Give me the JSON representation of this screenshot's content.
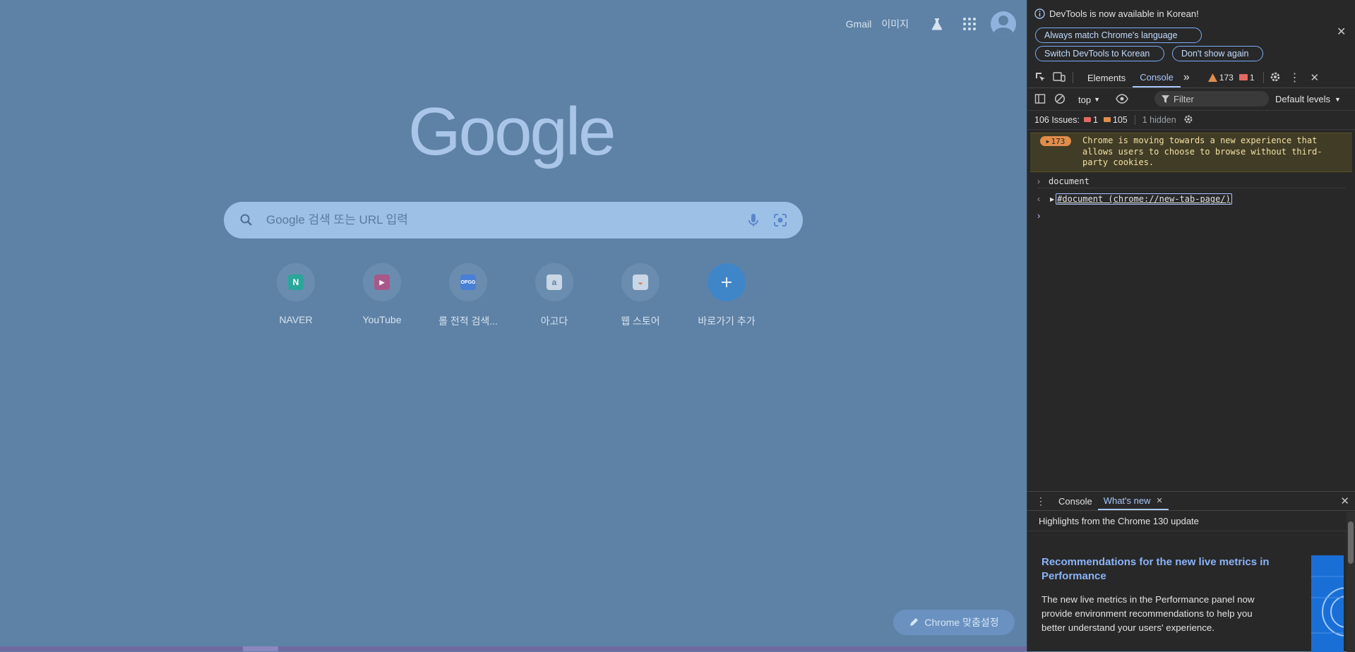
{
  "ntp": {
    "top_links": {
      "gmail": "Gmail",
      "images": "이미지"
    },
    "logo_text": "Google",
    "search": {
      "placeholder": "Google 검색 또는 URL 입력"
    },
    "shortcuts": [
      {
        "label": "NAVER",
        "icon": "naver-icon",
        "color": "#2bb34a"
      },
      {
        "label": "YouTube",
        "icon": "youtube-icon",
        "color": "#b23a6e"
      },
      {
        "label": "롤 전적 검색...",
        "icon": "opgg-icon",
        "color": "#4a7fd6"
      },
      {
        "label": "아고다",
        "icon": "agoda-icon",
        "color": "#e8eef6"
      },
      {
        "label": "웹 스토어",
        "icon": "webstore-icon",
        "color": "#e8eef6"
      },
      {
        "label": "바로가기 추가",
        "icon": "plus-icon",
        "color": "#3f86c8"
      }
    ],
    "customize_label": "Chrome 맞춤설정"
  },
  "devtools": {
    "banner": {
      "message": "DevTools is now available in Korean!",
      "btn_match": "Always match Chrome's language",
      "btn_switch": "Switch DevTools to Korean",
      "btn_dont_show": "Don't show again"
    },
    "tabs": {
      "elements": "Elements",
      "console": "Console"
    },
    "counts": {
      "warnings": "173",
      "errors": "1"
    },
    "toolbar": {
      "context": "top",
      "filter_placeholder": "Filter",
      "levels": "Default levels"
    },
    "issues": {
      "label": "106 Issues:",
      "errors": "1",
      "warnings": "105",
      "hidden": "1 hidden"
    },
    "console": {
      "warning_count": "173",
      "warning_text": "Chrome is moving towards a new experience that allows users to choose to browse without third-party cookies.",
      "input_line": "document",
      "result_line": "#document (chrome://new-tab-page/)"
    },
    "drawer": {
      "tab_console": "Console",
      "tab_whatsnew": "What's new",
      "highlights": "Highlights from the Chrome 130 update",
      "article_title": "Recommendations for the new live metrics in Performance",
      "article_body": "The new live metrics in the Performance panel now provide environment recommendations to help you better understand your users' experience."
    }
  }
}
